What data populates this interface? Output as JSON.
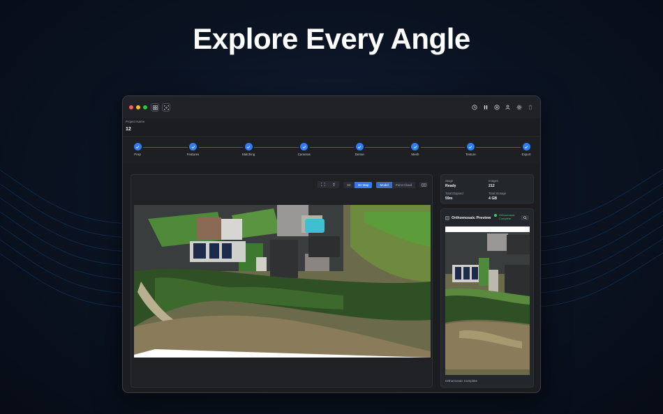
{
  "hero": {
    "title": "Explore Every Angle"
  },
  "window": {
    "traffic_colors": [
      "#ff5f57",
      "#febc2e",
      "#28c840"
    ],
    "left_icons": [
      "grid-icon",
      "focus-icon"
    ],
    "right_icons": [
      "history-icon",
      "pause-icon",
      "close-circle-icon",
      "user-settings-icon",
      "gear-icon",
      "trash-icon"
    ]
  },
  "project": {
    "label": "Project Name",
    "value": "12"
  },
  "steps": [
    {
      "label": "Prep"
    },
    {
      "label": "Features"
    },
    {
      "label": "Matching"
    },
    {
      "label": "Cameras"
    },
    {
      "label": "Dense"
    },
    {
      "label": "Mesh"
    },
    {
      "label": "Texture"
    },
    {
      "label": "Export"
    }
  ],
  "viewer": {
    "view_modes": [
      "3D",
      "2D Map"
    ],
    "active_view": "2D Map",
    "layers": [
      "Model",
      "Point Cloud"
    ],
    "active_layer": "Model"
  },
  "stats": {
    "stage_label": "Stage",
    "stage_value": "Ready",
    "images_label": "Images",
    "images_value": "212",
    "elapsed_label": "Total Elapsed",
    "elapsed_value": "59m",
    "storage_label": "Total Storage",
    "storage_value": "4 GB"
  },
  "preview": {
    "title": "Orthomosaic Preview",
    "badge": "Orthomosaic Complete",
    "footer": "Orthomosaic Complete"
  },
  "colors": {
    "accent": "#2f7cf6",
    "success": "#3ccb78"
  }
}
